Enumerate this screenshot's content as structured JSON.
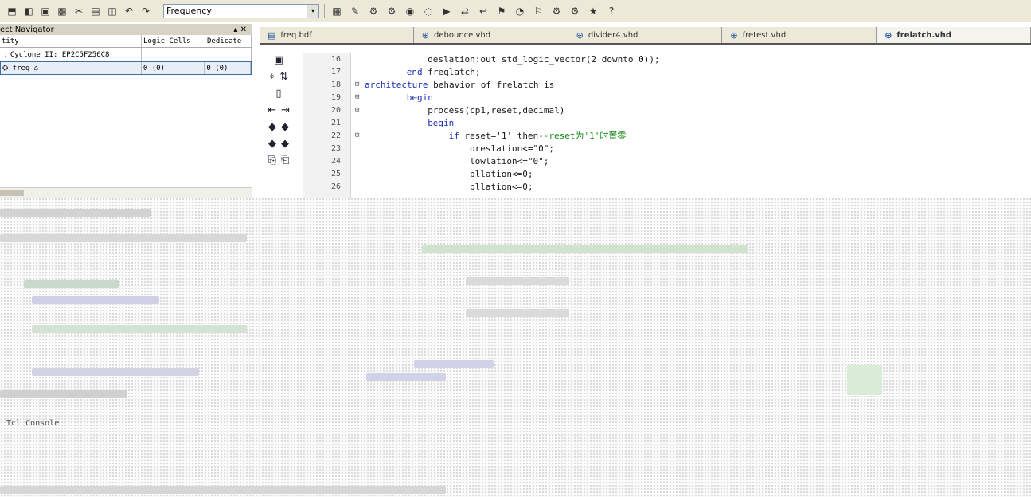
{
  "toolbar": {
    "combo_value": "Frequency",
    "combo_arrow": "▾",
    "icons_left": [
      "⬒",
      "◧",
      "▣",
      "▩",
      "✂",
      "▤",
      "◫",
      "↶",
      "↷"
    ],
    "icons_right": [
      "▦",
      "✎",
      "⚙",
      "⚙",
      "◉",
      "◌",
      "▶",
      "⇄",
      "↩",
      "⚑",
      "◔",
      "⚐",
      "⚙",
      "⚙",
      "★",
      "?"
    ]
  },
  "navigator": {
    "title": "ect Navigator",
    "pin_icon": "▴ ✕",
    "columns": [
      "tity",
      "Logic Cells",
      "Dedicate"
    ],
    "rows": [
      {
        "entity": "▢ Cyclone II: EP2C5F256C8",
        "cells": "",
        "ded": ""
      },
      {
        "entity": "  ⛭  freq ⌂",
        "cells": "0 (0)",
        "ded": "0 (0)"
      }
    ]
  },
  "tabs": [
    {
      "label": "freq.bdf",
      "icon": "▤",
      "active": false
    },
    {
      "label": "debounce.vhd",
      "icon": "⊕",
      "active": false
    },
    {
      "label": "divider4.vhd",
      "icon": "⊕",
      "active": false
    },
    {
      "label": "fretest.vhd",
      "icon": "⊕",
      "active": false
    },
    {
      "label": "frelatch.vhd",
      "icon": "⊕",
      "active": true
    }
  ],
  "side_icons": [
    [
      "▣",
      ""
    ],
    [
      "⌖",
      "⇅"
    ],
    [
      "▯",
      ""
    ],
    [
      "⇤",
      "⇥"
    ],
    [
      "◆",
      "◆"
    ],
    [
      "◆",
      "◆"
    ],
    [
      "⎘",
      "⎗"
    ]
  ],
  "code_lines": [
    {
      "num": "16",
      "fold": "",
      "indent": "            ",
      "text": "deslation:out std_logic_vector(2 downto 0));",
      "kw": ""
    },
    {
      "num": "17",
      "fold": "",
      "indent": "        ",
      "text": "freqlatch;",
      "kw": "end "
    },
    {
      "num": "18",
      "fold": "⊟",
      "indent": "",
      "text": " behavior of frelatch is",
      "kw": "architecture"
    },
    {
      "num": "19",
      "fold": "⊟",
      "indent": "        ",
      "text": "",
      "kw": "begin"
    },
    {
      "num": "20",
      "fold": "⊟",
      "indent": "            ",
      "text": "process(cp1,reset,decimal)",
      "kw": ""
    },
    {
      "num": "21",
      "fold": "",
      "indent": "            ",
      "text": "",
      "kw": "begin"
    },
    {
      "num": "22",
      "fold": "⊟",
      "indent": "                ",
      "text": " reset='1' then",
      "kw": "if",
      "comment": "--reset为'1'时置零"
    },
    {
      "num": "23",
      "fold": "",
      "indent": "                    ",
      "text": "oreslation<=\"0\";",
      "kw": ""
    },
    {
      "num": "24",
      "fold": "",
      "indent": "                    ",
      "text": "lowlation<=\"0\";",
      "kw": ""
    },
    {
      "num": "25",
      "fold": "",
      "indent": "                    ",
      "text": "pllation<=0;",
      "kw": ""
    },
    {
      "num": "26",
      "fold": "",
      "indent": "                    ",
      "text": "pllation<=0;",
      "kw": ""
    }
  ],
  "status_text": "Tcl Console"
}
